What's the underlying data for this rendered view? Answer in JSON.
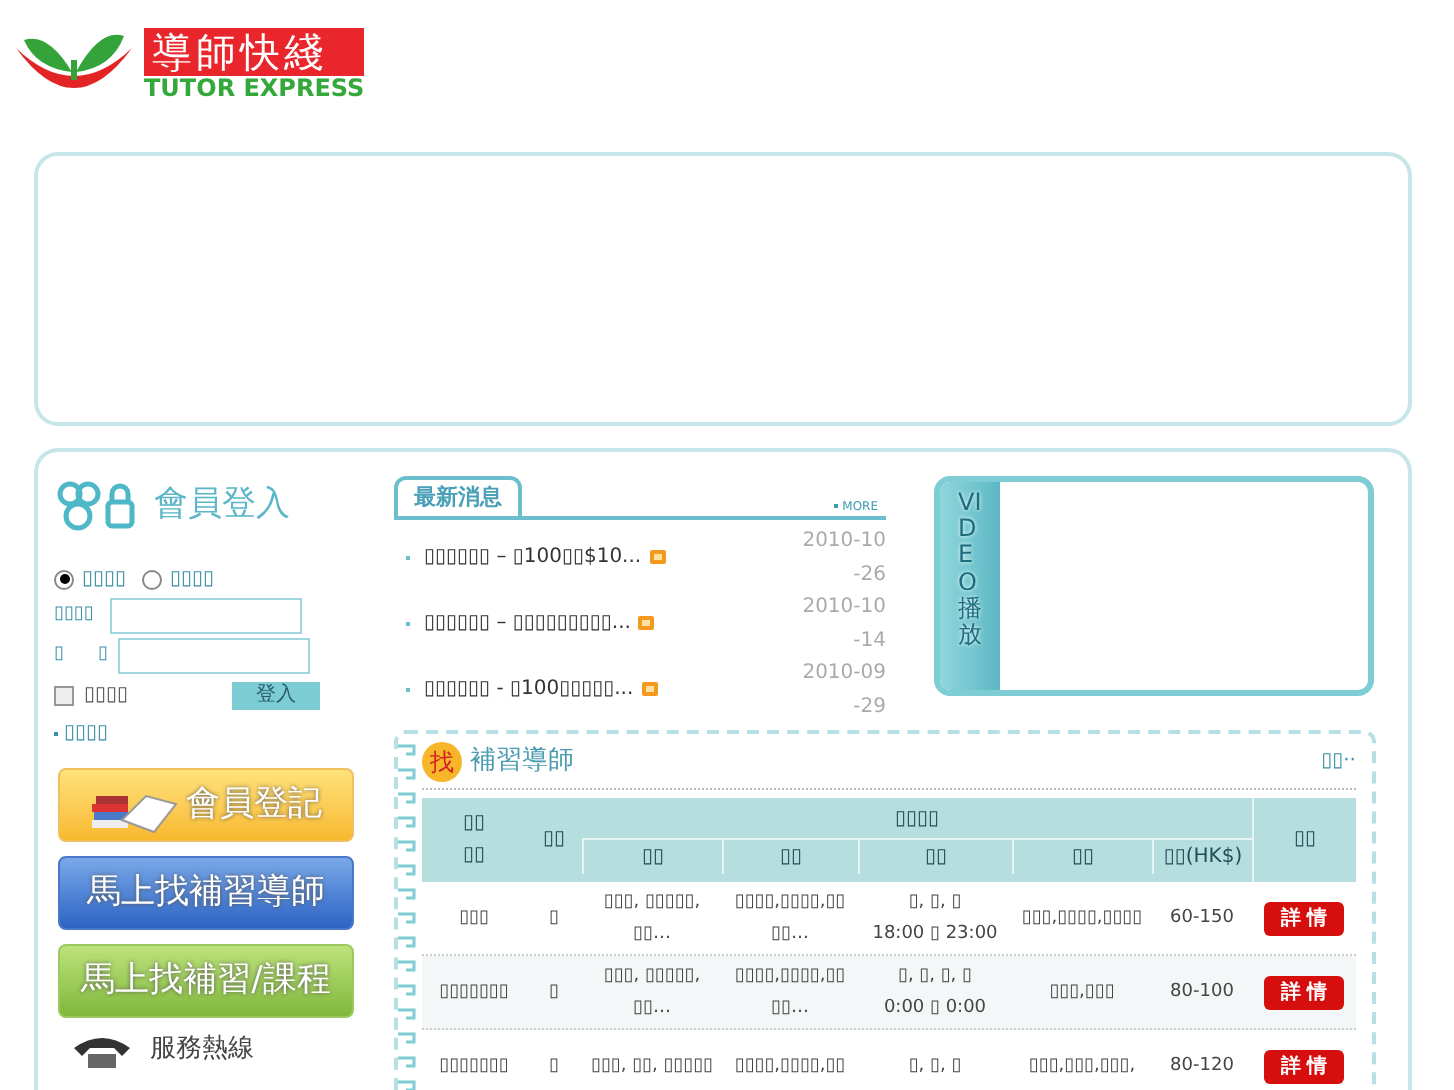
{
  "logo": {
    "title": "導師快綫",
    "subtitle": "TUTOR EXPRESS"
  },
  "login": {
    "title": "會員登入",
    "roles": [
      {
        "label": "▯▯▯▯",
        "selected": true
      },
      {
        "label": "▯▯▯▯",
        "selected": false
      }
    ],
    "username_label": "▯▯▯▯",
    "password_label": [
      "▯",
      "▯"
    ],
    "remember": {
      "label": "▯▯▯▯",
      "checked": false
    },
    "submit": "登入",
    "link": "▯▯▯▯"
  },
  "promo_buttons": [
    {
      "kind": "register",
      "label": "會員登記"
    },
    {
      "kind": "tutor",
      "label": "馬上找補習導師"
    },
    {
      "kind": "course",
      "label": "馬上找補習/課程"
    }
  ],
  "hotline": "服務熱線",
  "news": {
    "title": "最新消息",
    "more": "MORE",
    "items": [
      {
        "text": "▯▯▯▯▯▯ – ▯100▯▯$10...",
        "date": "2010-10-26",
        "new": true
      },
      {
        "text": "▯▯▯▯▯▯ – ▯▯▯▯▯▯▯▯▯...",
        "date": "2010-10-14",
        "new": true
      },
      {
        "text": "▯▯▯▯▯▯ - ▯100▯▯▯▯▯...",
        "date": "2010-09-29",
        "new": true
      }
    ]
  },
  "video": {
    "label": "VIDEO播放"
  },
  "tutors": {
    "badge": "找",
    "title": "補習導師",
    "more": "▯▯··",
    "group": "▯▯▯▯",
    "columns": [
      {
        "lines": [
          "▯▯",
          "▯▯"
        ]
      },
      {
        "lines": [
          "▯▯"
        ]
      },
      {
        "lines": [
          "▯▯"
        ]
      },
      {
        "lines": [
          "▯▯"
        ]
      },
      {
        "lines": [
          "▯▯"
        ]
      },
      {
        "lines": [
          "▯▯"
        ]
      },
      {
        "lines": [
          "▯▯(HK$)"
        ]
      },
      {
        "lines": [
          "▯▯"
        ]
      }
    ],
    "rows": [
      {
        "cells": [
          {
            "lines": [
              "▯▯▯"
            ]
          },
          {
            "lines": [
              "▯"
            ]
          },
          {
            "lines": [
              "▯▯▯, ▯▯▯▯▯,",
              "▯▯…"
            ]
          },
          {
            "lines": [
              "▯▯▯▯,▯▯▯▯,▯▯",
              "▯▯…"
            ]
          },
          {
            "lines": [
              "▯, ▯, ▯",
              "18:00 ▯ 23:00"
            ]
          },
          {
            "lines": [
              "▯▯▯,▯▯▯▯,▯▯▯▯"
            ]
          },
          {
            "lines": [
              "60-150"
            ]
          }
        ],
        "action": "詳 情"
      },
      {
        "cells": [
          {
            "lines": [
              "▯▯▯▯▯▯▯"
            ]
          },
          {
            "lines": [
              "▯"
            ]
          },
          {
            "lines": [
              "▯▯▯, ▯▯▯▯▯,",
              "▯▯…"
            ]
          },
          {
            "lines": [
              "▯▯▯▯,▯▯▯▯,▯▯",
              "▯▯…"
            ]
          },
          {
            "lines": [
              "▯, ▯, ▯, ▯",
              "0:00 ▯ 0:00"
            ]
          },
          {
            "lines": [
              "▯▯▯,▯▯▯"
            ]
          },
          {
            "lines": [
              "80-100"
            ]
          }
        ],
        "action": "詳 情"
      },
      {
        "cells": [
          {
            "lines": [
              "▯▯▯▯▯▯▯"
            ]
          },
          {
            "lines": [
              "▯"
            ]
          },
          {
            "lines": [
              "▯▯▯, ▯▯, ▯▯▯▯▯"
            ]
          },
          {
            "lines": [
              "▯▯▯▯,▯▯▯▯,▯▯"
            ]
          },
          {
            "lines": [
              "▯, ▯, ▯"
            ]
          },
          {
            "lines": [
              "▯▯▯,▯▯▯,▯▯▯,"
            ]
          },
          {
            "lines": [
              "80-120"
            ]
          }
        ],
        "action": "詳 情"
      }
    ]
  }
}
